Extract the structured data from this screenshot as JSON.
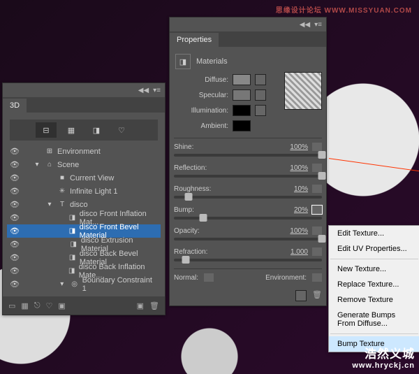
{
  "watermark": {
    "top": "思缘设计论坛  WWW.MISSYUAN.COM",
    "cn": "浩然义城",
    "url": "www.hryckj.cn"
  },
  "panel3d": {
    "title": "3D",
    "tree": [
      {
        "icon": "⊞",
        "label": "Environment",
        "ind": 0
      },
      {
        "icon": "⌂",
        "label": "Scene",
        "ind": 0,
        "exp": "▾"
      },
      {
        "icon": "■",
        "label": "Current View",
        "ind": 1
      },
      {
        "icon": "✳",
        "label": "Infinite Light 1",
        "ind": 1
      },
      {
        "icon": "T",
        "label": "disco",
        "ind": 1,
        "exp": "▾"
      },
      {
        "icon": "◨",
        "label": "disco Front Inflation Mat...",
        "ind": 2
      },
      {
        "icon": "◨",
        "label": "disco Front Bevel Material",
        "ind": 2,
        "sel": true
      },
      {
        "icon": "◨",
        "label": "disco Extrusion Material",
        "ind": 2
      },
      {
        "icon": "◨",
        "label": "disco Back Bevel Material",
        "ind": 2
      },
      {
        "icon": "◨",
        "label": "disco Back Inflation Mate...",
        "ind": 2
      },
      {
        "icon": "◎",
        "label": "Boundary Constraint 1",
        "ind": 2,
        "exp": "▾"
      }
    ]
  },
  "props": {
    "title": "Properties",
    "section": "Materials",
    "diffuse_label": "Diffuse:",
    "specular_label": "Specular:",
    "illum_label": "Illumination:",
    "ambient_label": "Ambient:",
    "sliders": [
      {
        "label": "Shine:",
        "value": "100%",
        "pos": 100
      },
      {
        "label": "Reflection:",
        "value": "100%",
        "pos": 100
      },
      {
        "label": "Roughness:",
        "value": "10%",
        "pos": 10
      },
      {
        "label": "Bump:",
        "value": "20%",
        "pos": 20,
        "hi": true
      },
      {
        "label": "Opacity:",
        "value": "100%",
        "pos": 100
      },
      {
        "label": "Refraction:",
        "value": "1.000",
        "pos": 8
      }
    ],
    "normal_label": "Normal:",
    "env_label": "Environment:"
  },
  "menu": {
    "items": [
      {
        "label": "Edit Texture..."
      },
      {
        "label": "Edit UV Properties..."
      },
      {
        "sep": true
      },
      {
        "label": "New Texture..."
      },
      {
        "label": "Replace Texture..."
      },
      {
        "label": "Remove Texture"
      },
      {
        "label": "Generate Bumps From Diffuse..."
      },
      {
        "sep": true
      },
      {
        "label": "Bump Texture",
        "hov": true
      }
    ]
  }
}
